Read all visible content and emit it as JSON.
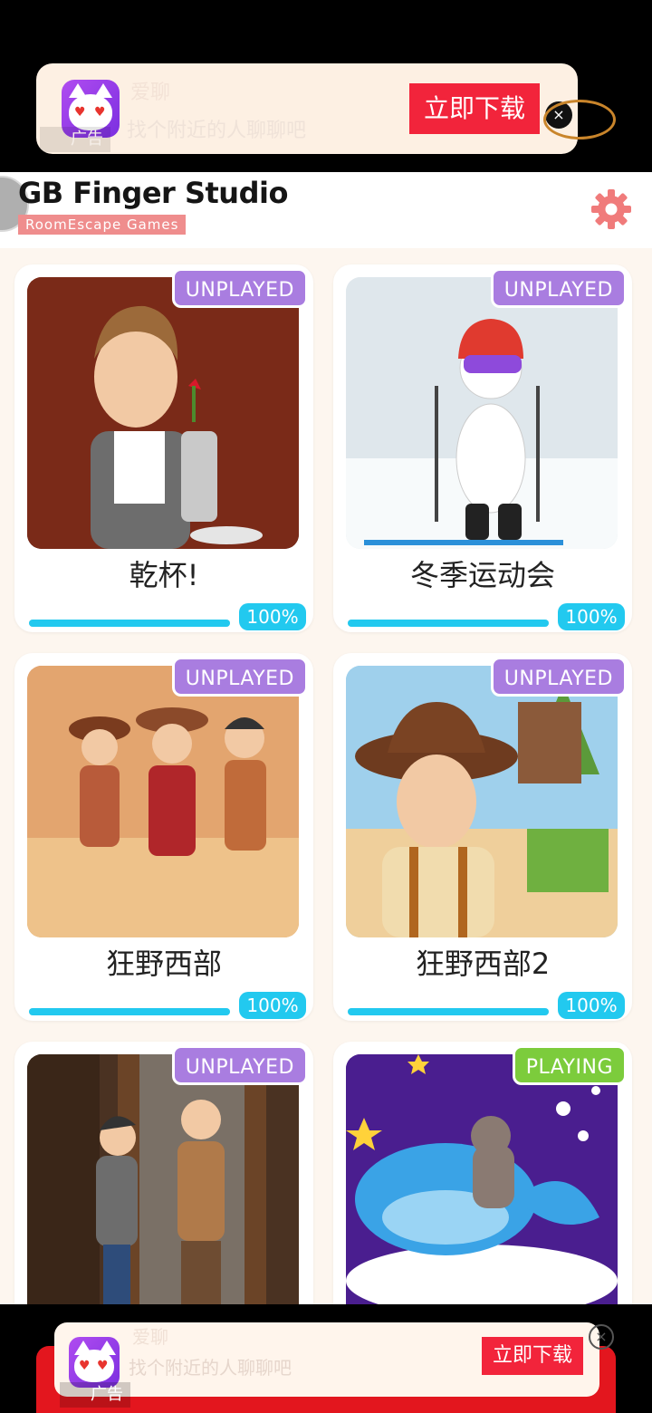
{
  "top_ad": {
    "app_name": "爱聊",
    "description": "找个附近的人聊聊吧",
    "ad_label": "广告",
    "download_label": "立即下载",
    "close_symbol": "×"
  },
  "header": {
    "logo_text": "GB Finger Studio",
    "logo_subtitle": "RoomEscape Games"
  },
  "games": [
    {
      "name": "乾杯!",
      "status": "UNPLAYED",
      "progress_label": "100%",
      "progress": 1.0
    },
    {
      "name": "冬季运动会",
      "status": "UNPLAYED",
      "progress_label": "100%",
      "progress": 1.0
    },
    {
      "name": "狂野西部",
      "status": "UNPLAYED",
      "progress_label": "100%",
      "progress": 1.0
    },
    {
      "name": "狂野西部2",
      "status": "UNPLAYED",
      "progress_label": "100%",
      "progress": 1.0
    },
    {
      "status": "UNPLAYED"
    },
    {
      "status": "PLAYING"
    }
  ],
  "bottom_ad": {
    "app_name": "爱聊",
    "description": "找个附近的人聊聊吧",
    "ad_label": "广告",
    "download_label": "立即下载",
    "close_symbol": "×"
  },
  "colors": {
    "unplayed_badge": "#a97de0",
    "playing_badge": "#7ccc3c",
    "progress": "#22c9ef",
    "ad_button": "#f2243b"
  }
}
